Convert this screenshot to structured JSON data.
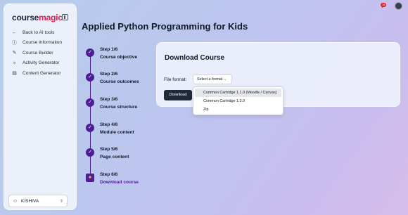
{
  "sidebar": {
    "logo": {
      "part1": "course",
      "part2": "magic"
    },
    "items": [
      {
        "label": "Back to AI tools",
        "icon": "arrow-left-icon"
      },
      {
        "label": "Course Information",
        "icon": "info-icon"
      },
      {
        "label": "Course Builder",
        "icon": "wand-icon"
      },
      {
        "label": "Activity Generator",
        "icon": "activity-icon"
      },
      {
        "label": "Content Generator",
        "icon": "document-icon"
      }
    ],
    "user": {
      "name": "KISHIVA"
    }
  },
  "header": {
    "notification_count": "14"
  },
  "page": {
    "title": "Applied Python Programming for Kids"
  },
  "steps": [
    {
      "step": "Step 1/6",
      "name": "Course objective",
      "status": "done"
    },
    {
      "step": "Step 2/6",
      "name": "Course outcomes",
      "status": "done"
    },
    {
      "step": "Step 3/6",
      "name": "Course structure",
      "status": "done"
    },
    {
      "step": "Step 4/6",
      "name": "Module content",
      "status": "done"
    },
    {
      "step": "Step 5/6",
      "name": "Page content",
      "status": "done"
    },
    {
      "step": "Step 6/6",
      "name": "Download course",
      "status": "active"
    }
  ],
  "card": {
    "title": "Download Course",
    "file_format_label": "File format:",
    "select_placeholder": "Select a format",
    "download_label": "Download",
    "options": [
      "Common Cartridge 1.1.0 (Moodle / Canvas)",
      "Common Cartridge 1.3.0",
      "Zip"
    ],
    "highlighted_option_index": 0
  },
  "colors": {
    "accent": "#4c1d95",
    "logo_accent": "#e11d48",
    "button": "#1f2937"
  }
}
